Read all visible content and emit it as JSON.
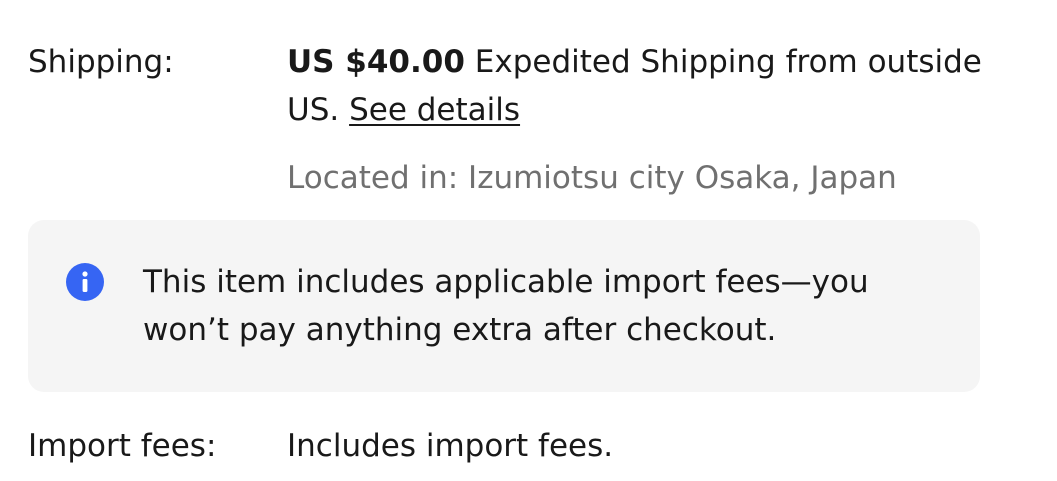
{
  "shipping": {
    "label": "Shipping:",
    "price": "US $40.00",
    "description": " Expedited Shipping from outside US. ",
    "details_link": "See details",
    "location": "Located in: Izumiotsu city Osaka, Japan"
  },
  "notice": {
    "icon": "info-icon",
    "icon_color": "#3665f3",
    "text": "This item includes applicable import fees—you won’t pay anything extra after checkout."
  },
  "import_fees": {
    "label": "Import fees:",
    "value": "Includes import fees."
  }
}
